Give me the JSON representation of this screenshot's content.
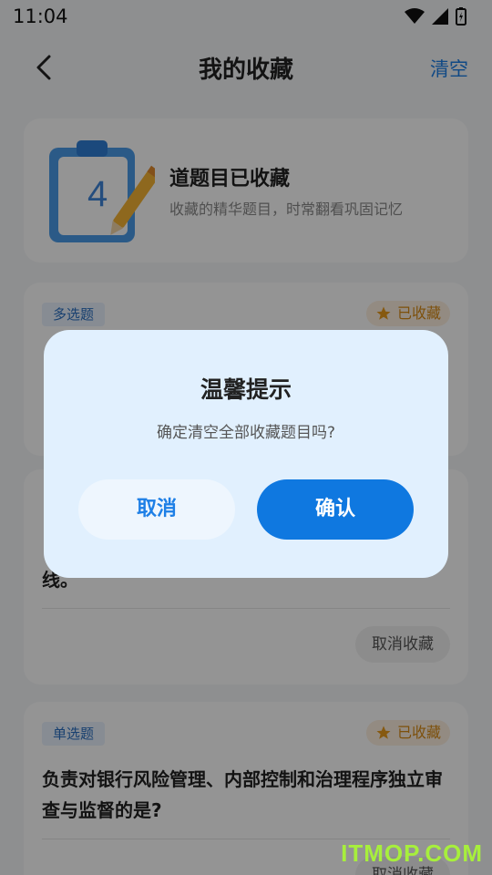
{
  "status": {
    "time": "11:04"
  },
  "nav": {
    "title": "我的收藏",
    "action": "清空"
  },
  "hero": {
    "count": "4",
    "title": "道题目已收藏",
    "subtitle": "收藏的精华题目，时常翻看巩固记忆"
  },
  "cards": [
    {
      "tag": "多选题",
      "fav": "已收藏"
    },
    {
      "question_tail": "线。",
      "remove": "取消收藏"
    },
    {
      "tag": "单选题",
      "fav": "已收藏",
      "question": "负责对银行风险管理、内部控制和治理程序独立审查与监督的是?",
      "remove": "取消收藏"
    }
  ],
  "dialog": {
    "title": "温馨提示",
    "message": "确定清空全部收藏题目吗?",
    "cancel": "取消",
    "confirm": "确认"
  },
  "watermark": "ITMOP.COM",
  "colors": {
    "accent": "#0f78e0",
    "fav": "#d88a14",
    "dialog_bg": "#e1f0fe"
  }
}
